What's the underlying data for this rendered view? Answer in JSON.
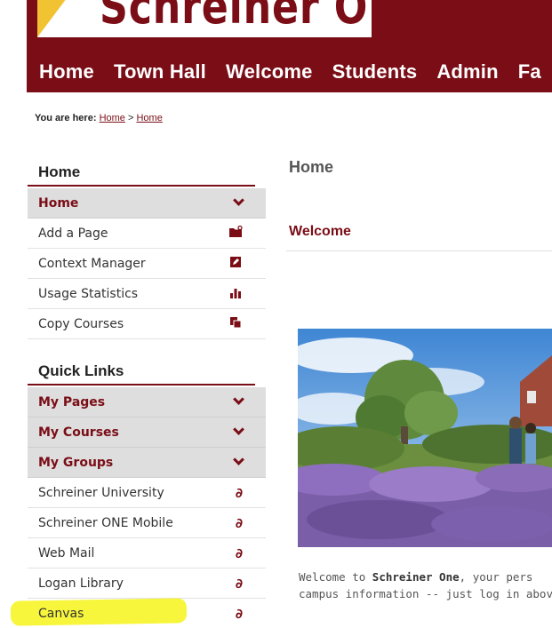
{
  "header": {
    "logo_text": "Schreiner ONE",
    "nav": [
      "Home",
      "Town Hall",
      "Welcome",
      "Students",
      "Admin",
      "Fa"
    ]
  },
  "breadcrumb": {
    "label": "You are here:",
    "crumb1": "Home",
    "separator": ">",
    "crumb2": "Home"
  },
  "sidebar": {
    "home_section": {
      "title": "Home",
      "items": [
        {
          "label": "Home",
          "icon": "chevron-down-icon",
          "expanded": true
        },
        {
          "label": "Add a Page",
          "icon": "folder-add-icon"
        },
        {
          "label": "Context Manager",
          "icon": "edit-icon"
        },
        {
          "label": "Usage Statistics",
          "icon": "bar-chart-icon"
        },
        {
          "label": "Copy Courses",
          "icon": "copy-icon"
        }
      ]
    },
    "quick_links": {
      "title": "Quick Links",
      "groups": [
        {
          "label": "My Pages",
          "icon": "chevron-down-icon"
        },
        {
          "label": "My Courses",
          "icon": "chevron-down-icon"
        },
        {
          "label": "My Groups",
          "icon": "chevron-down-icon"
        }
      ],
      "links": [
        {
          "label": "Schreiner University",
          "icon": "link-icon"
        },
        {
          "label": "Schreiner ONE Mobile",
          "icon": "link-icon"
        },
        {
          "label": "Web Mail",
          "icon": "link-icon"
        },
        {
          "label": "Logan Library",
          "icon": "link-icon"
        },
        {
          "label": "Canvas",
          "icon": "link-icon",
          "highlighted": true
        }
      ]
    }
  },
  "main": {
    "page_title": "Home",
    "welcome_heading": "Welcome",
    "intro_prefix": "Welcome to ",
    "intro_bold": "Schreiner One",
    "intro_suffix": ", your pers",
    "intro_line2": "campus information -- just log in abov"
  },
  "colors": {
    "brand": "#7a0d16",
    "accent": "#f1c232",
    "highlight": "#f6f51a"
  }
}
